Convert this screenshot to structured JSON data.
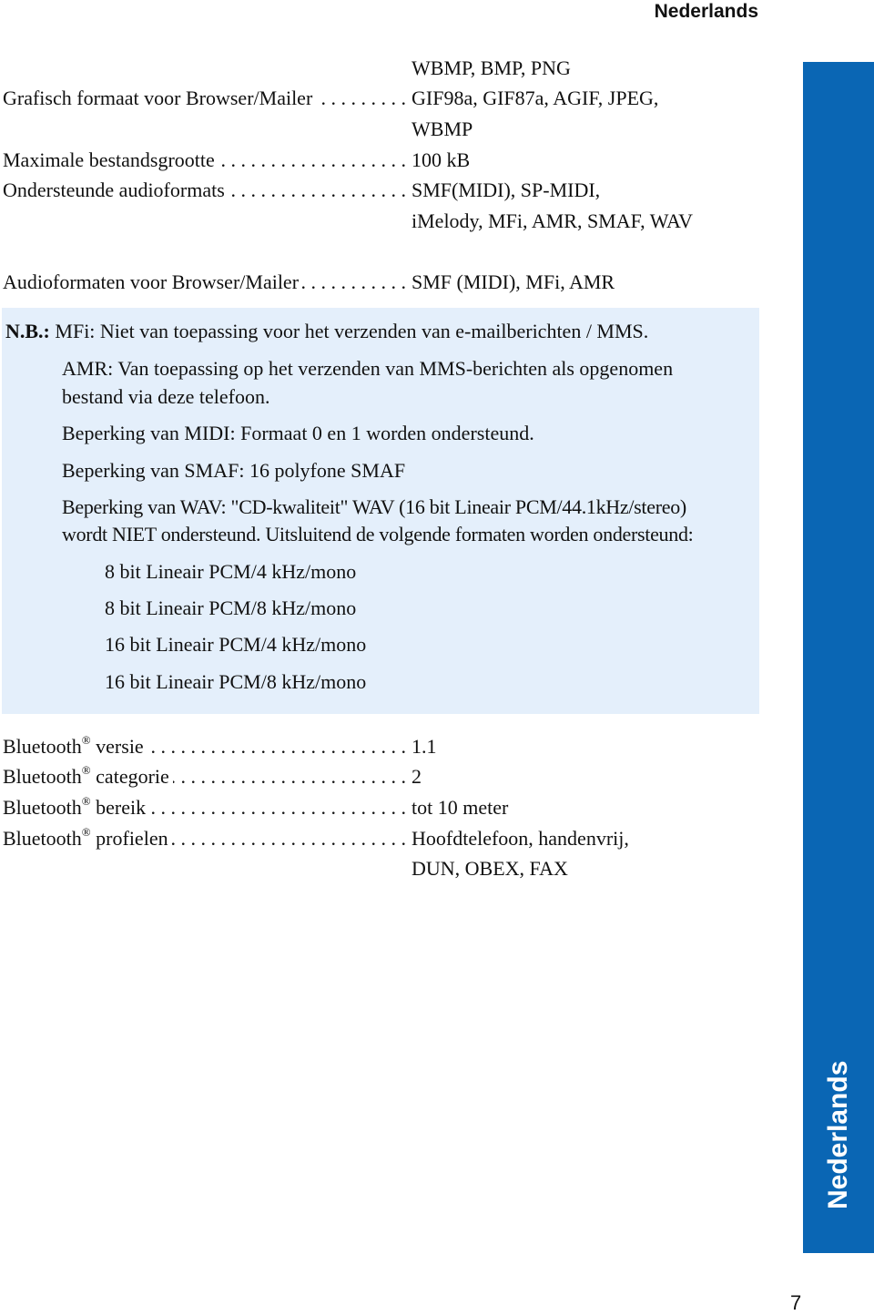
{
  "header": {
    "language": "Nederlands"
  },
  "sidebar": {
    "label": "Nederlands",
    "color": "#0a66b4"
  },
  "page_number": "7",
  "specs_top": [
    {
      "label": "",
      "values": [
        "WBMP, BMP, PNG"
      ]
    },
    {
      "label": "Grafisch formaat voor Browser/Mailer",
      "values": [
        "GIF98a, GIF87a, AGIF, JPEG,",
        "WBMP"
      ]
    },
    {
      "label": "Maximale bestandsgrootte",
      "values": [
        "100 kB"
      ]
    },
    {
      "label": "Ondersteunde audioformats",
      "values": [
        "SMF(MIDI), SP-MIDI,",
        "iMelody, MFi, AMR, SMAF, WAV"
      ]
    },
    {
      "label": "Audioformaten voor Browser/Mailer",
      "values": [
        "SMF (MIDI), MFi, AMR"
      ]
    }
  ],
  "note": {
    "prefix": "N.B.:",
    "background": "#e4effb",
    "lines": [
      "MFi: Niet van toepassing voor het verzenden van e-mailberichten / MMS.",
      "AMR: Van toepassing op het verzenden van MMS-berichten als opgenomen",
      "bestand via deze telefoon.",
      "Beperking van MIDI: Formaat 0 en 1 worden ondersteund.",
      "Beperking van SMAF: 16 polyfone SMAF",
      "Beperking van WAV: \"CD-kwaliteit\" WAV (16 bit Lineair PCM/44.1kHz/stereo)",
      "wordt NIET ondersteund. Uitsluitend de volgende formaten worden ondersteund:"
    ],
    "formats": [
      "8 bit Lineair PCM/4 kHz/mono",
      "8 bit Lineair PCM/8 kHz/mono",
      "16 bit Lineair PCM/4 kHz/mono",
      "16 bit Lineair PCM/8 kHz/mono"
    ]
  },
  "bluetooth": {
    "brand": "Bluetooth",
    "reg": "®",
    "rows": [
      {
        "label": "versie",
        "values": [
          "1.1"
        ]
      },
      {
        "label": "categorie",
        "values": [
          "2"
        ]
      },
      {
        "label": "bereik",
        "values": [
          "tot 10 meter"
        ]
      },
      {
        "label": "profielen",
        "values": [
          "Hoofdtelefoon, handenvrij,",
          "DUN, OBEX, FAX"
        ]
      }
    ]
  }
}
